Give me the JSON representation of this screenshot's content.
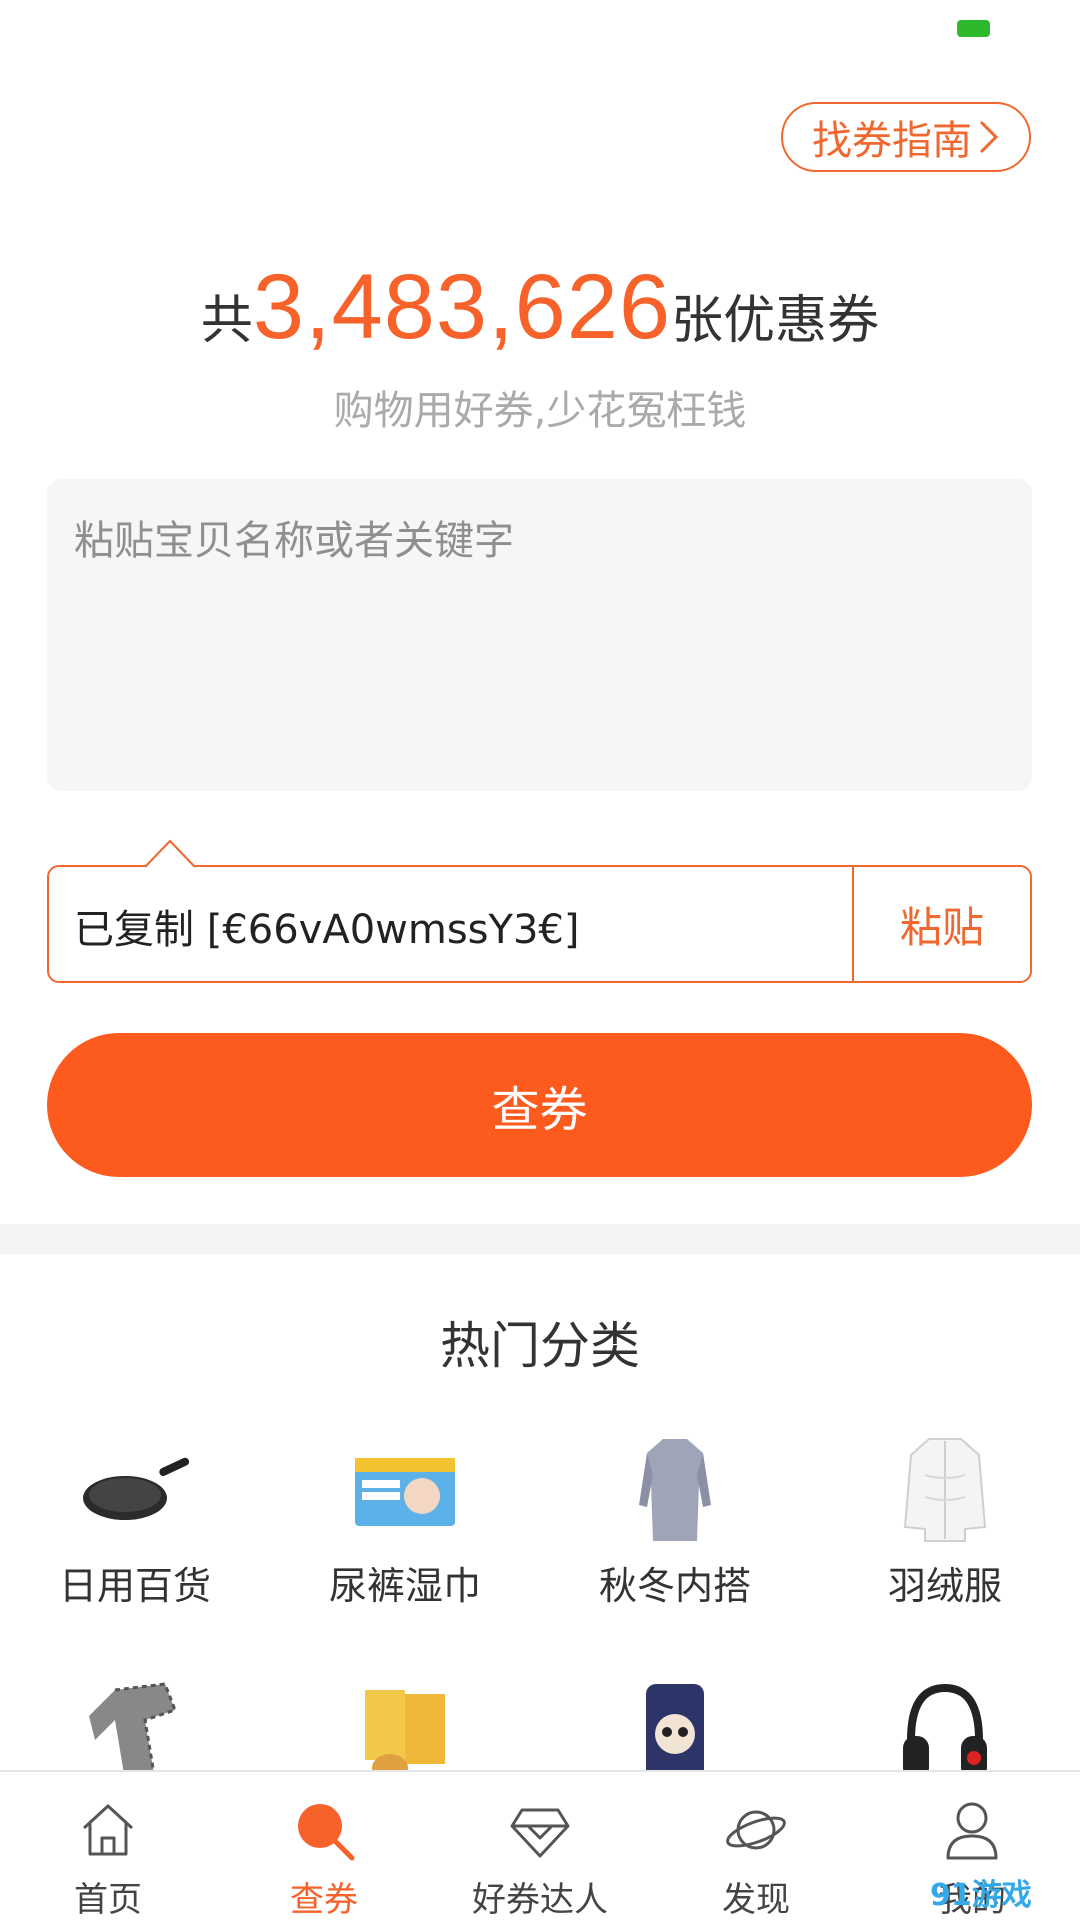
{
  "header": {
    "guide_button": "找券指南"
  },
  "hero": {
    "prefix": "共",
    "count": "3,483,626",
    "suffix": "张优惠券",
    "slogan": "购物用好券,少花冤枉钱"
  },
  "search": {
    "placeholder": "粘贴宝贝名称或者关键字",
    "clipboard_text": "已复制 [€66vA0wmssY3€]",
    "paste_label": "粘贴",
    "submit_label": "查券"
  },
  "categories": {
    "title": "热门分类",
    "items": [
      {
        "label": "日用百货",
        "icon": "frying-pan-icon"
      },
      {
        "label": "尿裤湿巾",
        "icon": "diapers-icon"
      },
      {
        "label": "秋冬内搭",
        "icon": "sweater-dress-icon"
      },
      {
        "label": "羽绒服",
        "icon": "down-jacket-icon"
      },
      {
        "label": "",
        "icon": "scarf-icon"
      },
      {
        "label": "",
        "icon": "snacks-icon"
      },
      {
        "label": "",
        "icon": "phone-case-icon"
      },
      {
        "label": "",
        "icon": "headphones-icon"
      }
    ]
  },
  "bottom_nav": [
    {
      "label": "首页",
      "icon": "home-icon",
      "active": false
    },
    {
      "label": "查券",
      "icon": "search-icon",
      "active": true
    },
    {
      "label": "好券达人",
      "icon": "diamond-icon",
      "active": false
    },
    {
      "label": "发现",
      "icon": "planet-icon",
      "active": false
    },
    {
      "label": "我的",
      "icon": "user-icon",
      "active": false
    }
  ],
  "colors": {
    "accent": "#f7612a",
    "button": "#fd5a1e",
    "status_battery": "#2db82d"
  },
  "watermark": "91游戏"
}
